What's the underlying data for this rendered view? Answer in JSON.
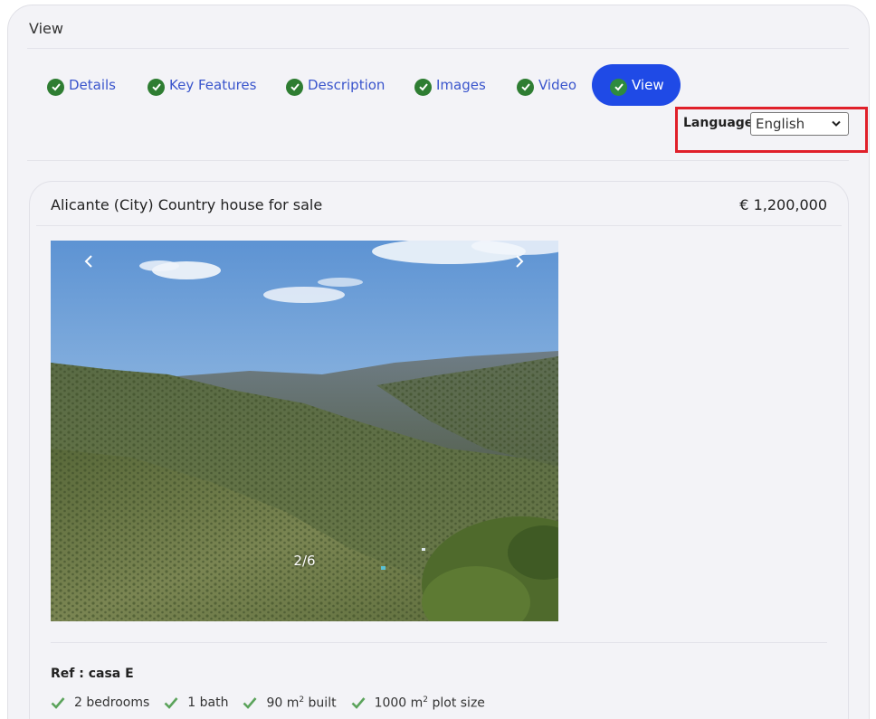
{
  "header": {
    "title": "View"
  },
  "tabs": [
    {
      "label": "Details"
    },
    {
      "label": "Key Features"
    },
    {
      "label": "Description"
    },
    {
      "label": "Images"
    },
    {
      "label": "Video"
    },
    {
      "label": "View",
      "active": true
    }
  ],
  "language": {
    "label": "Language",
    "selected": "English"
  },
  "listing": {
    "title": "Alicante (City) Country house for sale",
    "price": "€ 1,200,000",
    "gallery_counter": "2/6",
    "ref": "Ref : casa E",
    "features": [
      {
        "value": "2 bedrooms"
      },
      {
        "value": "1 bath"
      },
      {
        "value": "90 m",
        "sup": "2",
        "suffix": " built"
      },
      {
        "value": "1000 m",
        "sup": "2",
        "suffix": " plot size"
      }
    ]
  },
  "colors": {
    "accent": "#1f4ae6",
    "link": "#3a55cc",
    "check_green": "#2e7d32",
    "feature_check": "#5ba35b",
    "highlight_box": "#e0202a"
  },
  "icons": {
    "tab_status": "check-circle-icon",
    "gallery_prev": "chevron-left-icon",
    "gallery_next": "chevron-right-icon",
    "feature": "check-icon",
    "select": "chevron-down-icon"
  }
}
